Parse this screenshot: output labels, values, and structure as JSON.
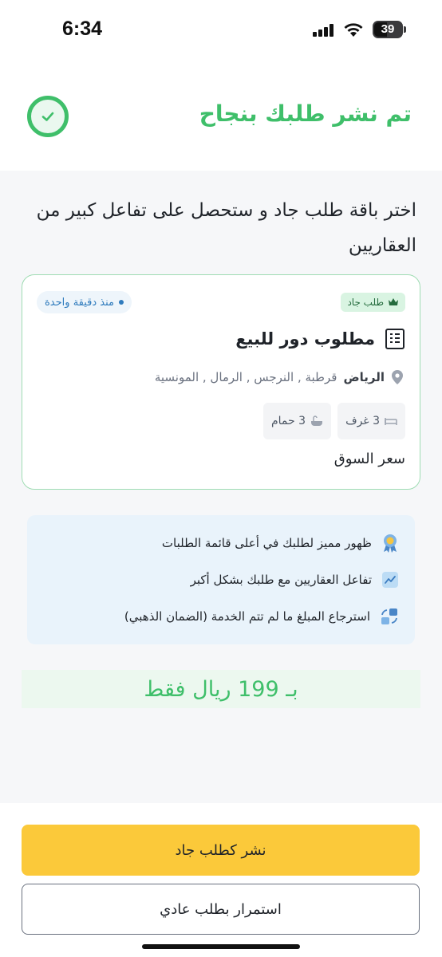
{
  "status_bar": {
    "time": "6:34",
    "battery_level": "39"
  },
  "header": {
    "title": "تم نشر طلبك بنجاح",
    "check_icon": "check-circle-icon",
    "accent_color": "#3fbf6a"
  },
  "promo": {
    "text": "اختر باقة طلب جاد و ستحصل على تفاعل كبير من العقاريين"
  },
  "card": {
    "tag": "طلب جاد",
    "tag_icon": "crown-icon",
    "time_ago": "منذ دقيقة واحدة",
    "title": "مطلوب دور للبيع",
    "title_icon": "building-icon",
    "city": "الرياض",
    "districts": "قرطبة , النرجس , الرمال , المونسية",
    "location_icon": "location-pin-icon",
    "rooms": "3 غرف",
    "rooms_icon": "bed-icon",
    "baths": "3 حمام",
    "baths_icon": "bathtub-icon",
    "price_type": "سعر السوق"
  },
  "benefits": [
    {
      "text": "ظهور مميز لطلبك في أعلى قائمة الطلبات",
      "icon": "award-badge-icon"
    },
    {
      "text": "تفاعل العقاريين مع طلبك بشكل أكبر",
      "icon": "trend-chart-icon"
    },
    {
      "text": "استرجاع المبلغ ما لم تتم الخدمة (الضمان الذهبي)",
      "icon": "refund-icon"
    }
  ],
  "price": {
    "text": "بـ 199 ريال فقط"
  },
  "actions": {
    "primary": "نشر كطلب جاد",
    "secondary": "استمرار بطلب عادي",
    "primary_color": "#fbc93a"
  }
}
